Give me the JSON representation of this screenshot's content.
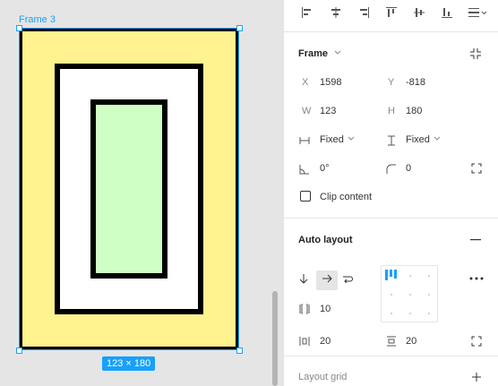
{
  "canvas": {
    "frame_label": "Frame 3",
    "size_badge": "123 × 180"
  },
  "colors": {
    "outer_fill": "#fff38f",
    "middle_fill": "#ffffff",
    "inner_fill": "#cfffc4",
    "selection": "#18a0fb"
  },
  "align_tools": [
    "align-left-icon",
    "align-horizontal-center-icon",
    "align-right-icon",
    "align-top-icon",
    "align-vertical-center-icon",
    "align-bottom-icon",
    "distribute-icon"
  ],
  "frame": {
    "title": "Frame",
    "x_label": "X",
    "x_value": "1598",
    "y_label": "Y",
    "y_value": "-818",
    "w_label": "W",
    "w_value": "123",
    "h_label": "H",
    "h_value": "180",
    "w_sizing": "Fixed",
    "h_sizing": "Fixed",
    "rotation": "0°",
    "radius": "0",
    "clip_label": "Clip content"
  },
  "auto_layout": {
    "title": "Auto layout",
    "spacing": "10",
    "padding_h": "20",
    "padding_v": "20"
  },
  "layout_grid": {
    "title": "Layout grid"
  }
}
